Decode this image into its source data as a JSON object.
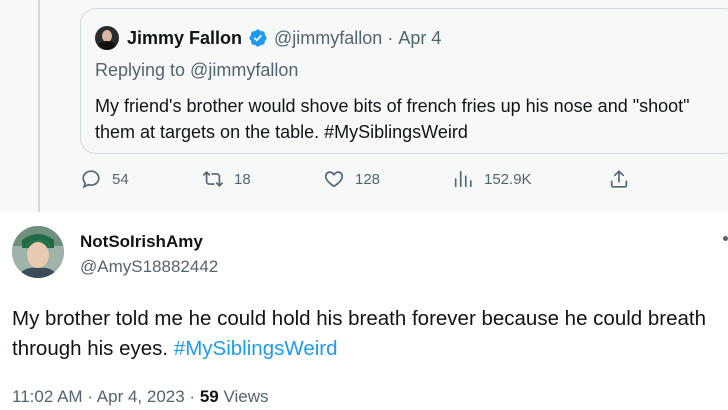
{
  "quoted": {
    "name": "Jimmy Fallon",
    "handle": "@jimmyfallon",
    "separator": "·",
    "date": "Apr 4",
    "replying": "Replying to @jimmyfallon",
    "text": "My friend's brother would shove bits of french fries up his nose and \"shoot\" them at targets on the table. #MySiblingsWeird",
    "verified_icon": "verified-badge-icon",
    "accent": "#1d9bf0"
  },
  "actions": {
    "replies": "54",
    "retweets": "18",
    "likes": "128",
    "views": "152.9K"
  },
  "tweet": {
    "name": "NotSoIrishAmy",
    "handle": "@AmyS18882442",
    "text_main": "My brother told me he could hold his breath forever because he could breath through his eyes.",
    "hashtag": "#MySiblingsWeird",
    "time": "11:02 AM",
    "sep1": "·",
    "date": "Apr 4, 2023",
    "sep2": "·",
    "views_count": "59",
    "views_label": "Views"
  }
}
